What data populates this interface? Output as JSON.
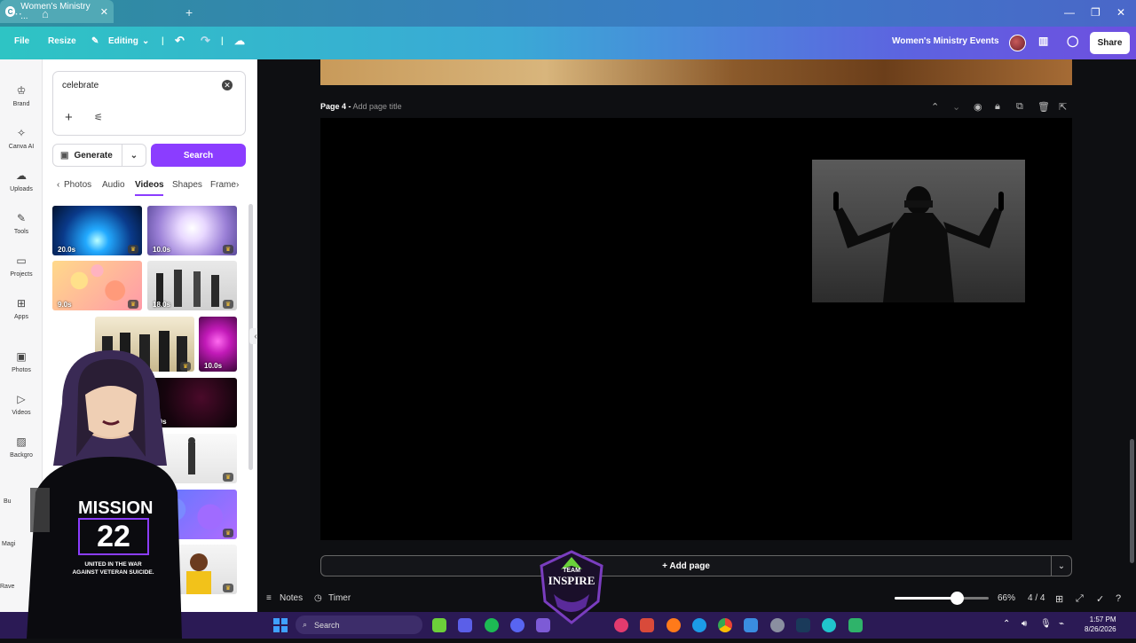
{
  "browser": {
    "tab_title": "Women's Ministry ...",
    "new_tab": "+",
    "menu": "⋯",
    "minimize": "—",
    "maximize": "❐",
    "close": "✕"
  },
  "topbar": {
    "file": "File",
    "resize": "Resize",
    "editing": "Editing",
    "design_title": "Women's Ministry Events",
    "share": "Share"
  },
  "rail": [
    {
      "label": "Brand",
      "icon": "brand-icon"
    },
    {
      "label": "Canva AI",
      "icon": "canva-ai-icon"
    },
    {
      "label": "Uploads",
      "icon": "uploads-icon"
    },
    {
      "label": "Tools",
      "icon": "tools-icon"
    },
    {
      "label": "Projects",
      "icon": "projects-icon"
    },
    {
      "label": "Apps",
      "icon": "apps-icon"
    },
    {
      "label": "Photos",
      "icon": "photos-icon"
    },
    {
      "label": "Videos",
      "icon": "videos-icon"
    },
    {
      "label": "Backgro",
      "icon": "background-icon"
    },
    {
      "label": "Bu",
      "icon": "brand-kit-icon"
    },
    {
      "label": "Magi",
      "icon": "magic-icon"
    },
    {
      "label": "Rave",
      "icon": "rave-icon"
    }
  ],
  "panel": {
    "search_value": "celebrate",
    "generate": "Generate",
    "search": "Search",
    "tabs": [
      "Photos",
      "Audio",
      "Videos",
      "Shapes",
      "Frame"
    ],
    "active_tab": "Videos",
    "durations": [
      "20.0s",
      "10.0s",
      "9.0s",
      "18.0s",
      "10.0s",
      "8.0s"
    ]
  },
  "workspace": {
    "page_label": "Page 4 -",
    "page_title_placeholder": "Add page title",
    "add_page": "+ Add page"
  },
  "bottombar": {
    "notes": "Notes",
    "timer": "Timer",
    "zoom": "66%",
    "zoom_fraction": 0.66,
    "pages": "4 / 4"
  },
  "overlay": {
    "shirt_line1": "MISSION",
    "shirt_line2": "22",
    "shirt_line3": "UNITED IN THE WAR",
    "shirt_line4": "AGAINST VETERAN SUICIDE.",
    "team_top": "TEAM",
    "team_name": "INSPIRE"
  },
  "taskbar": {
    "search": "Search",
    "time": "1:57 PM",
    "date": "8/26/2026"
  },
  "colors": {
    "accent": "#8b3dff",
    "topbar_start": "#2ec4c4",
    "topbar_end": "#6e4fe0",
    "taskbar": "#2b1a55"
  }
}
